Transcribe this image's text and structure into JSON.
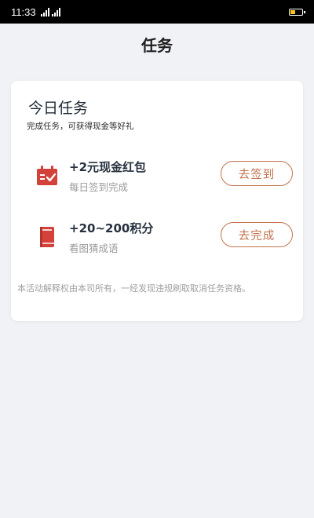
{
  "status_bar": {
    "time": "11:33",
    "battery_level": 0.5,
    "battery_color": "#f5c518"
  },
  "header": {
    "title": "任务"
  },
  "card": {
    "title": "今日任务",
    "subtitle": "完成任务，可获得现金等好礼",
    "tasks": [
      {
        "icon": "calendar-check-icon",
        "name": "+2元现金红包",
        "desc": "每日签到完成",
        "button": "去签到"
      },
      {
        "icon": "book-icon",
        "name": "+20~200积分",
        "desc": "看图猜成语",
        "button": "去完成"
      }
    ],
    "notice": "本活动解释权由本司所有，一经发现违规刷取取消任务资格。"
  },
  "colors": {
    "accent": "#c3724f",
    "icon_red": "#d2413a",
    "background": "#f1f2f5"
  }
}
